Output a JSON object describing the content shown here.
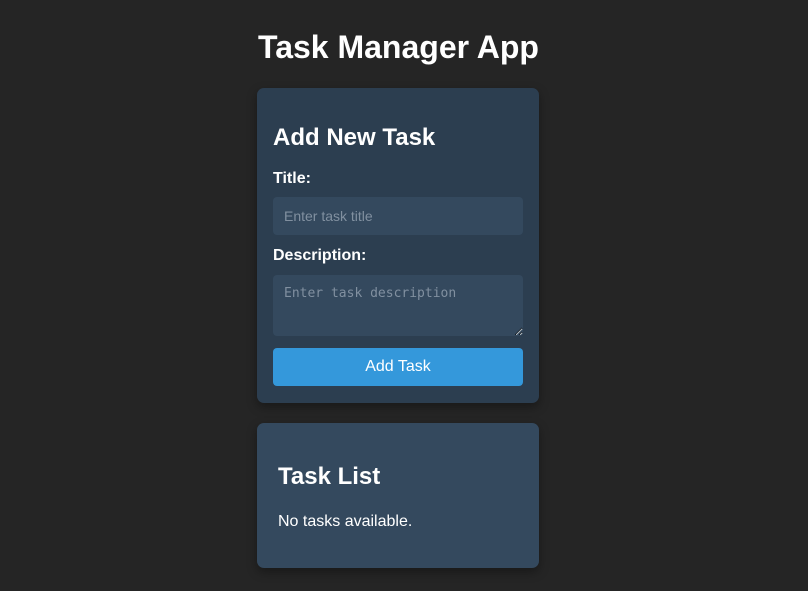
{
  "app": {
    "title": "Task Manager App"
  },
  "form": {
    "heading": "Add New Task",
    "title_label": "Title:",
    "title_placeholder": "Enter task title",
    "title_value": "",
    "description_label": "Description:",
    "description_placeholder": "Enter task description",
    "description_value": "",
    "submit_label": "Add Task"
  },
  "task_list": {
    "heading": "Task List",
    "empty_message": "No tasks available.",
    "tasks": []
  },
  "colors": {
    "background": "#252525",
    "form_card": "#2c3e50",
    "list_card": "#34495e",
    "input_bg": "#34495e",
    "accent": "#3498db",
    "text": "#ffffff"
  }
}
